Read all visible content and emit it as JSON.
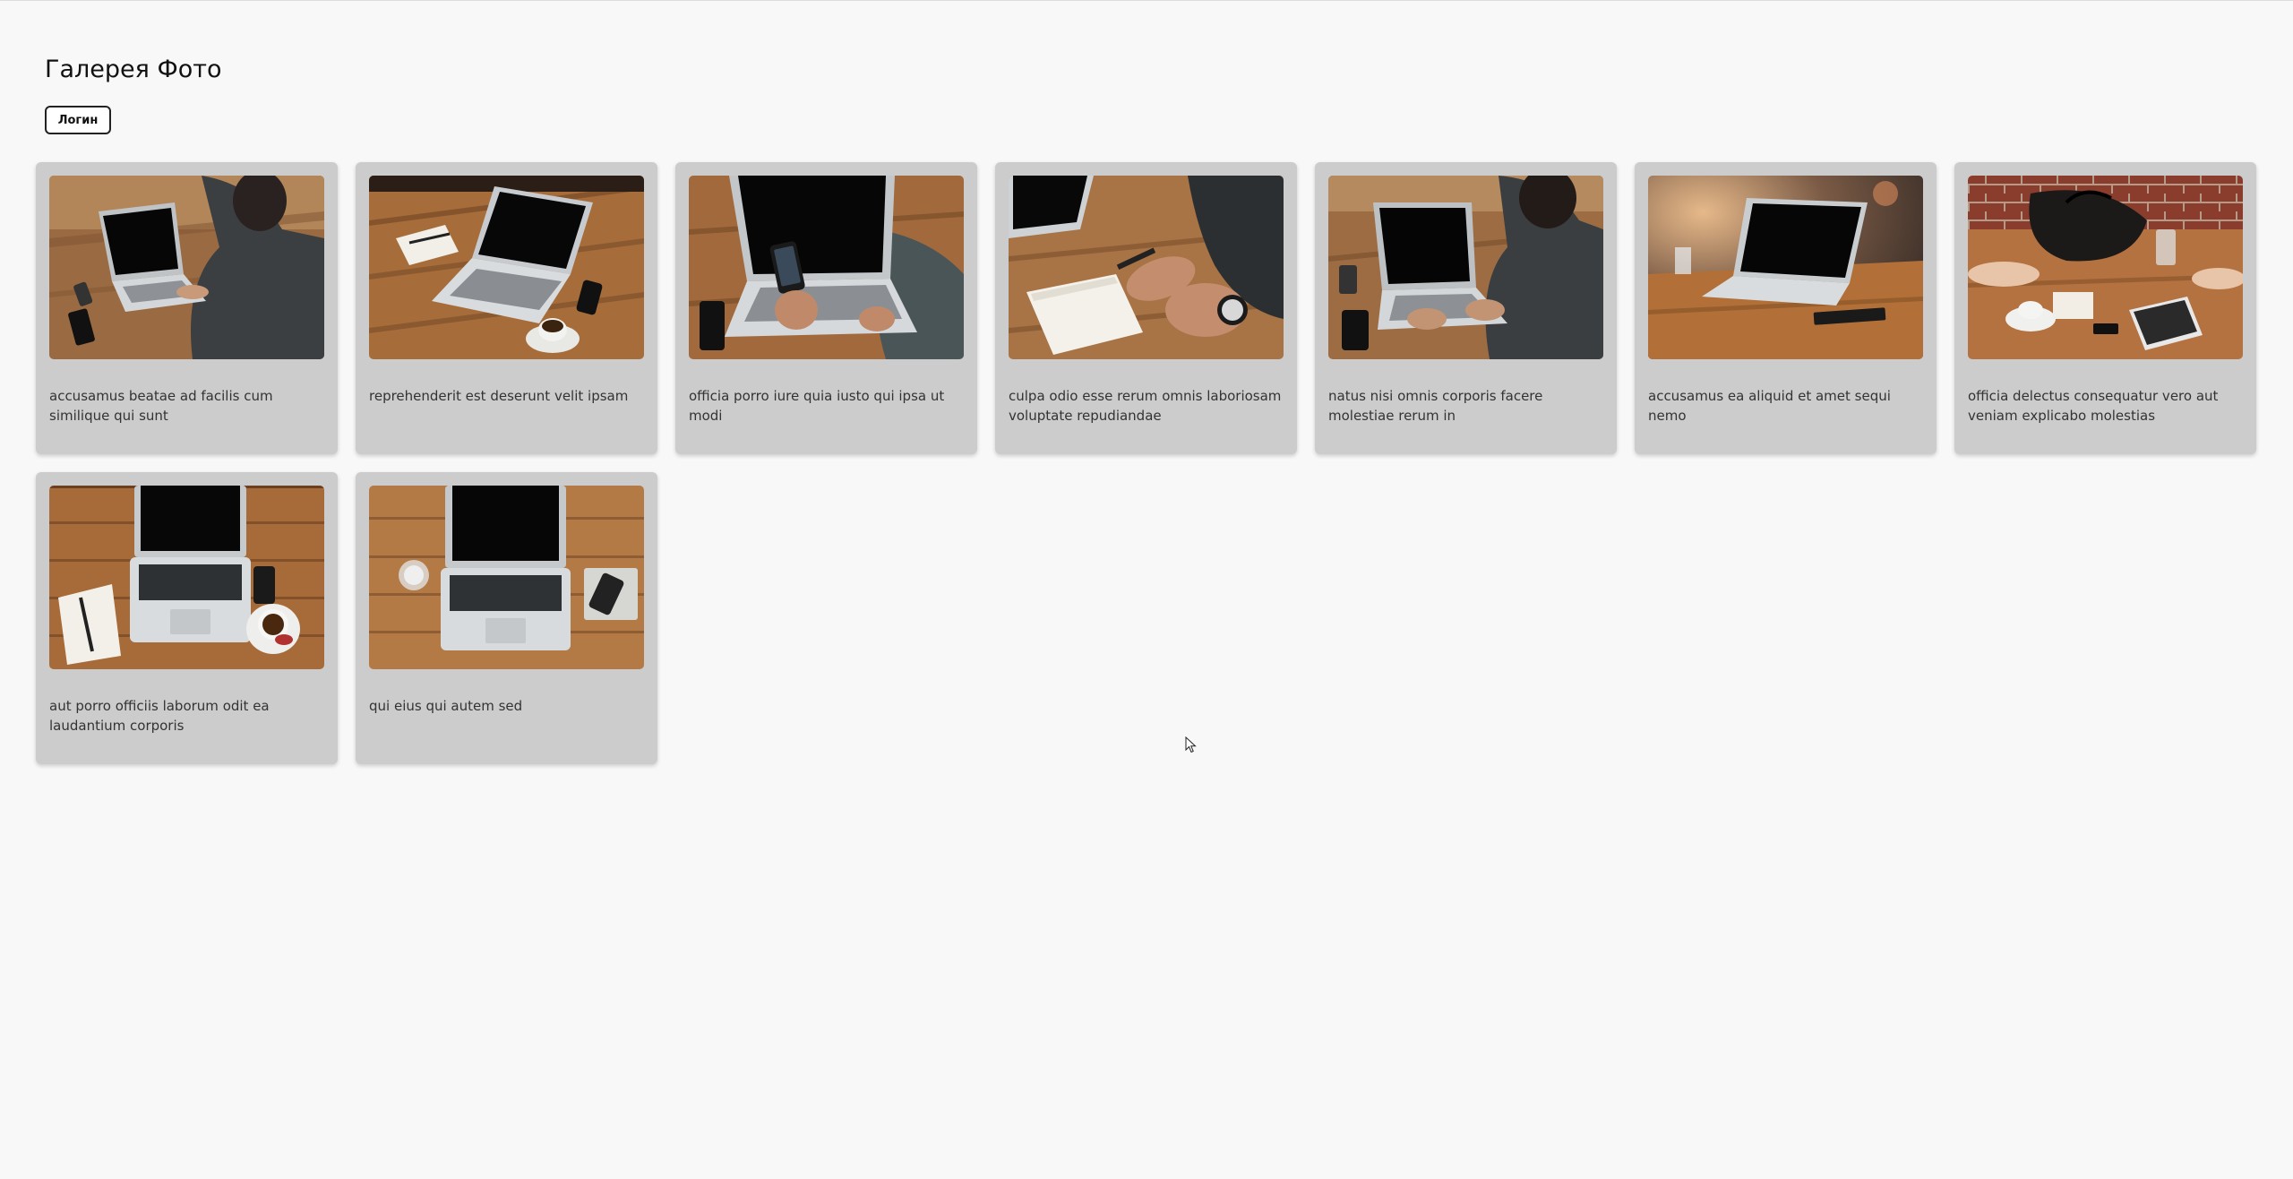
{
  "page": {
    "title": "Галерея Фото",
    "login_label": "Логин"
  },
  "gallery": {
    "items": [
      {
        "caption": "accusamus beatae ad facilis cum similique qui sunt",
        "icon": "photo-laptop-person-typing"
      },
      {
        "caption": "reprehenderit est deserunt velit ipsam",
        "icon": "photo-laptop-coffee"
      },
      {
        "caption": "officia porro iure quia iusto qui ipsa ut modi",
        "icon": "photo-laptop-phone-hands"
      },
      {
        "caption": "culpa odio esse rerum omnis laboriosam voluptate repudiandae",
        "icon": "photo-hands-notebook-watch"
      },
      {
        "caption": "natus nisi omnis corporis facere molestiae rerum in",
        "icon": "photo-laptop-person-typing"
      },
      {
        "caption": "accusamus ea aliquid et amet sequi nemo",
        "icon": "photo-laptop-outdoor-table"
      },
      {
        "caption": "officia delectus consequatur vero aut veniam explicabo molestias",
        "icon": "photo-table-bag-tablet"
      },
      {
        "caption": "aut porro officiis laborum odit ea laudantium corporis",
        "icon": "photo-laptop-topdown-coffee"
      },
      {
        "caption": "qui eius qui autem sed",
        "icon": "photo-laptop-topdown-glass"
      }
    ]
  },
  "colors": {
    "background": "#f8f8f8",
    "card": "#cccccc",
    "wood": "#a0693a",
    "screen": "#0a0a0a"
  }
}
